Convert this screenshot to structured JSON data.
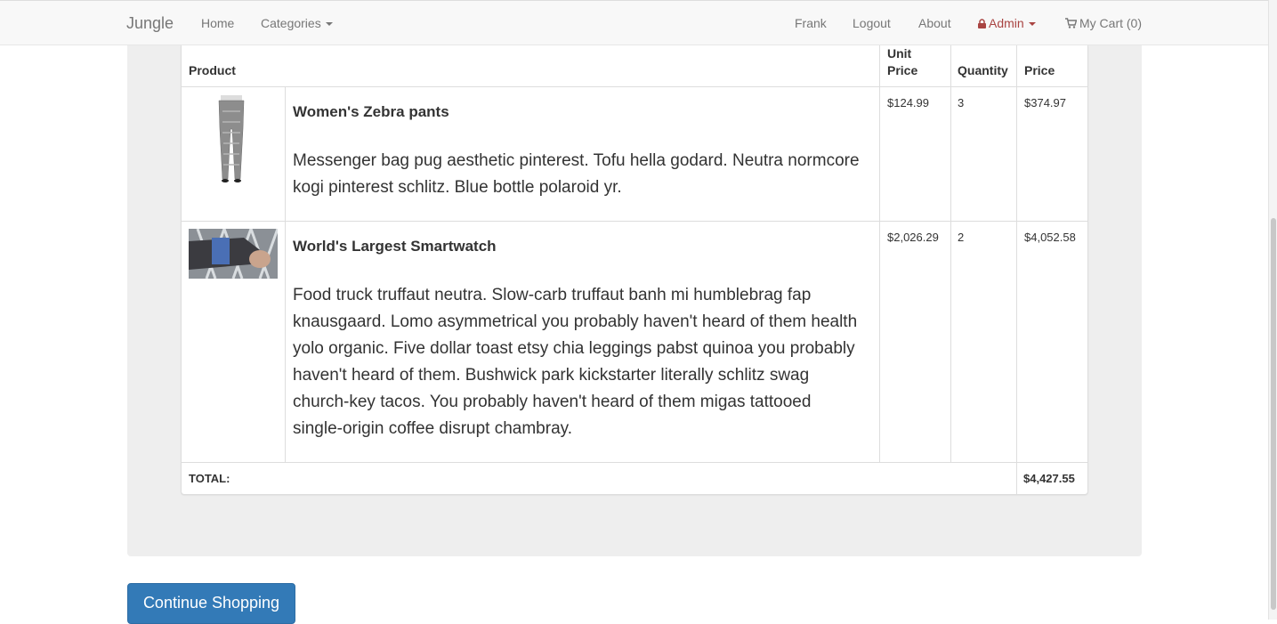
{
  "navbar": {
    "brand": "Jungle",
    "home": "Home",
    "categories": "Categories",
    "user": "Frank",
    "logout": "Logout",
    "about": "About",
    "admin": "Admin",
    "cart": "My Cart (0)"
  },
  "table": {
    "headers": {
      "product": "Product",
      "unit_price_line1": "Unit",
      "unit_price_line2": "Price",
      "quantity": "Quantity",
      "price": "Price"
    },
    "rows": [
      {
        "name": "Women's Zebra pants",
        "description": "Messenger bag pug aesthetic pinterest. Tofu hella godard. Neutra normcore kogi pinterest schlitz. Blue bottle polaroid yr.",
        "unit_price": "$124.99",
        "quantity": "3",
        "price": "$374.97"
      },
      {
        "name": "World's Largest Smartwatch",
        "description": "Food truck truffaut neutra. Slow-carb truffaut banh mi humblebrag fap knausgaard. Lomo asymmetrical you probably haven't heard of them health yolo organic. Five dollar toast etsy chia leggings pabst quinoa you probably haven't heard of them. Bushwick park kickstarter literally schlitz swag church-key tacos. You probably haven't heard of them migas tattooed single-origin coffee disrupt chambray.",
        "unit_price": "$2,026.29",
        "quantity": "2",
        "price": "$4,052.58"
      }
    ],
    "total_label": "TOTAL:",
    "total_value": "$4,427.55"
  },
  "actions": {
    "continue_shopping": "Continue Shopping"
  },
  "colors": {
    "primary": "#337ab7",
    "admin": "#a94442"
  }
}
